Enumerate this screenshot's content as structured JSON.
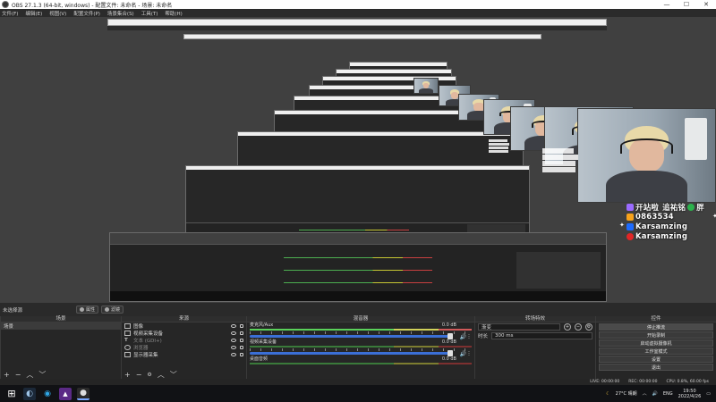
{
  "window": {
    "title": "OBS 27.1.3 (64-bit, windows) - 配置文件: 未命名 - 场景: 未命名",
    "minimize": "—",
    "maximize": "☐",
    "close": "✕"
  },
  "menu": [
    "文件(F)",
    "编辑(E)",
    "视图(V)",
    "配置文件(P)",
    "场景集合(S)",
    "工具(T)",
    "帮助(H)"
  ],
  "overlay": {
    "rows": [
      {
        "text": "开站啦",
        "icon_color": "#9b6bff"
      },
      {
        "text": "0863534",
        "icon_color": "#f7a21b"
      },
      {
        "text": "Karsamzing",
        "icon_color": "#1e6bff"
      },
      {
        "text": "Karsamzing",
        "icon_color": "#e22626"
      }
    ],
    "tags": [
      "追祐铭",
      "胖"
    ]
  },
  "scene_bar": {
    "label": "未选择源",
    "props_button": "属性",
    "filters_button": "滤镜"
  },
  "scenes": {
    "title": "场景",
    "items": [
      "场景"
    ]
  },
  "sources": {
    "title": "来源",
    "items": [
      {
        "name": "图像",
        "dim": false
      },
      {
        "name": "视频采集设备",
        "dim": false
      },
      {
        "name": "文本 (GDI+)",
        "dim": true
      },
      {
        "name": "浏览器",
        "dim": true
      },
      {
        "name": "显示器采集",
        "dim": false
      }
    ]
  },
  "mixer": {
    "title": "混音器",
    "channels": [
      {
        "name": "麦克风/Aux",
        "db": "0.0 dB",
        "active": true
      },
      {
        "name": "视频采集设备",
        "db": "0.0 dB",
        "active": false
      },
      {
        "name": "桌面音频",
        "db": "0.0 dB",
        "active": false
      }
    ]
  },
  "transitions": {
    "title": "转场特效",
    "selected": "渐变",
    "duration_label": "时长",
    "duration_value": "300 ms"
  },
  "controls": {
    "title": "控件",
    "buttons": [
      "停止推流",
      "开始录制",
      "启动虚拟摄像机",
      "工作室模式",
      "设置",
      "退出"
    ]
  },
  "status": {
    "live": "LIVE: 00:00:00",
    "rec": "REC: 00:00:00",
    "cpu": "CPU: 0.8%, 60.00 fps"
  },
  "tray": {
    "weather": "27°C 晴朗",
    "lang": "ENG",
    "time": "19:50",
    "date": "2022/4/26"
  }
}
